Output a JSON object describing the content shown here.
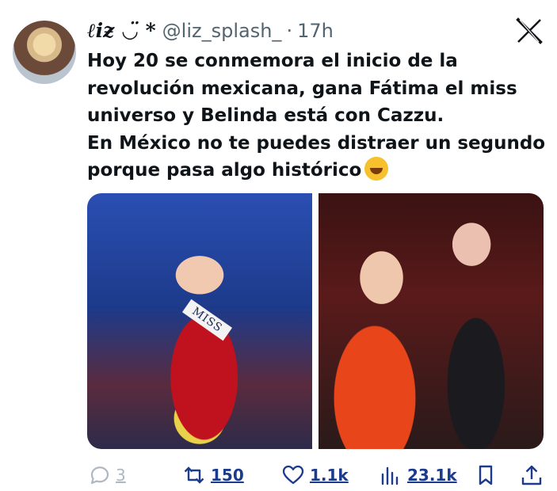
{
  "author": {
    "display_name": "ℓiƶ ◡̈ *",
    "handle": "@liz_splash_",
    "separator": "·",
    "time": "17h"
  },
  "tweet": {
    "text": "Hoy 20 se conmemora el inicio  de la revolución mexicana, gana Fátima el miss universo  y Belinda está con Cazzu.\nEn México no te puedes distraer un segundo porque pasa algo histórico",
    "emoji": "rolling-on-floor-laughing-emoji"
  },
  "media": {
    "sash_text": "MISS"
  },
  "actions": {
    "replies": "3",
    "reposts": "150",
    "likes": "1.1k",
    "views": "23.1k"
  },
  "colors": {
    "text": "#0f1419",
    "muted": "#536471",
    "link": "#1d3b8c"
  }
}
